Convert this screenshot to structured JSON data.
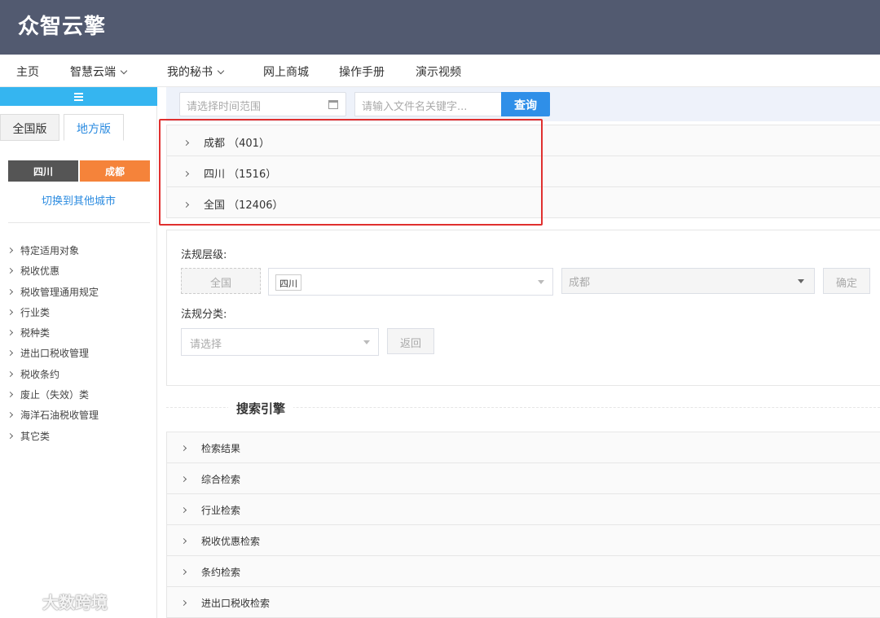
{
  "header": {
    "logo": "众智云擎"
  },
  "nav": {
    "items": [
      {
        "label": "主页"
      },
      {
        "label": "智慧云端",
        "dropdown": true
      },
      {
        "label": "我的秘书",
        "dropdown": true
      },
      {
        "label": "网上商城"
      },
      {
        "label": "操作手册"
      },
      {
        "label": "演示视频"
      }
    ]
  },
  "sidebar": {
    "tabs": [
      {
        "label": "全国版"
      },
      {
        "label": "地方版",
        "active": true
      }
    ],
    "region": {
      "province": "四川",
      "city": "成都"
    },
    "switch_city": "切换到其他城市",
    "categories": [
      "特定适用对象",
      "税收优惠",
      "税收管理通用规定",
      "行业类",
      "税种类",
      "进出口税收管理",
      "税收条约",
      "废止（失效）类",
      "海洋石油税收管理",
      "其它类"
    ]
  },
  "search": {
    "date_placeholder": "请选择时间范围",
    "keyword_placeholder": "请输入文件名关键字...",
    "query_label": "查询"
  },
  "results": [
    {
      "label": "成都 （401）"
    },
    {
      "label": "四川 （1516）"
    },
    {
      "label": "全国 （12406）"
    }
  ],
  "filters": {
    "level_label": "法规层级:",
    "all_label": "全国",
    "province_tag": "四川",
    "city_value": "成都",
    "confirm_label": "确定",
    "class_label": "法规分类:",
    "class_placeholder": "请选择",
    "back_label": "返回"
  },
  "search_engine": {
    "title": "搜索引擎",
    "items": [
      "检索结果",
      "综合检索",
      "行业检索",
      "税收优惠检索",
      "条约检索",
      "进出口税收检索"
    ]
  },
  "watermark": "大数跨境",
  "colors": {
    "topbar": "#525a70",
    "accent_blue": "#2f8fe8",
    "sidebar_toggle": "#35b5f0",
    "city_orange": "#f5833a",
    "highlight_red": "#e0302f"
  }
}
